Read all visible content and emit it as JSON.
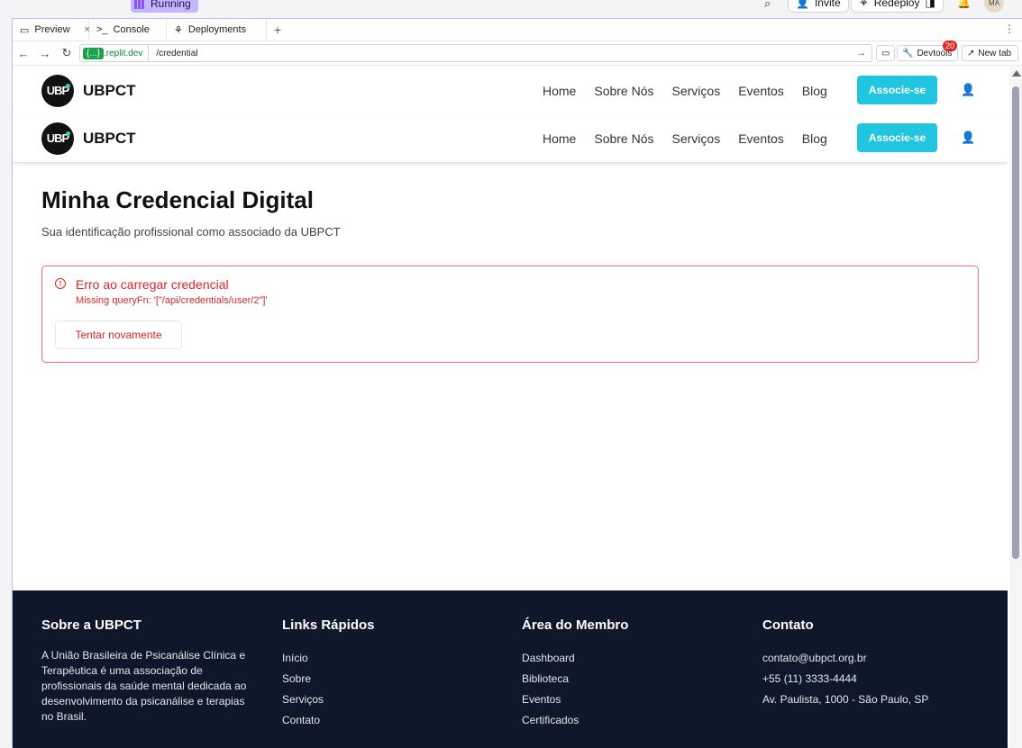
{
  "appbar": {
    "status": "Running",
    "invite": "Invite",
    "redeploy": "Redeploy",
    "avatar": "MA"
  },
  "tabs": [
    {
      "label": "Preview"
    },
    {
      "label": "Console"
    },
    {
      "label": "Deployments"
    }
  ],
  "url": {
    "host_badge": "{...}",
    "domain": ".replit.dev",
    "path": "/credential",
    "devtools": "Devtools",
    "devtools_badge": "20",
    "new_tab": "New tab"
  },
  "site": {
    "brand": "UBPCT",
    "logo_text": "UBP",
    "nav": [
      "Home",
      "Sobre Nós",
      "Serviços",
      "Eventos",
      "Blog"
    ],
    "cta": "Associe-se"
  },
  "page": {
    "title": "Minha Credencial Digital",
    "subtitle": "Sua identificação profissional como associado da UBPCT"
  },
  "error": {
    "title": "Erro ao carregar credencial",
    "message": "Missing queryFn: '[\"/api/credentials/user/2\"]'",
    "retry": "Tentar novamente"
  },
  "footer": {
    "about": {
      "heading": "Sobre a UBPCT",
      "text": "A União Brasileira de Psicanálise Clínica e Terapêutica é uma associação de profissionais da saúde mental dedicada ao desenvolvimento da psicanálise e terapias no Brasil."
    },
    "links": {
      "heading": "Links Rápidos",
      "items": [
        "Início",
        "Sobre",
        "Serviços",
        "Contato"
      ]
    },
    "member": {
      "heading": "Área do Membro",
      "items": [
        "Dashboard",
        "Biblioteca",
        "Eventos",
        "Certificados"
      ]
    },
    "contact": {
      "heading": "Contato",
      "items": [
        "contato@ubpct.org.br",
        "+55 (11) 3333-4444",
        "Av. Paulista, 1000 - São Paulo, SP"
      ]
    }
  }
}
